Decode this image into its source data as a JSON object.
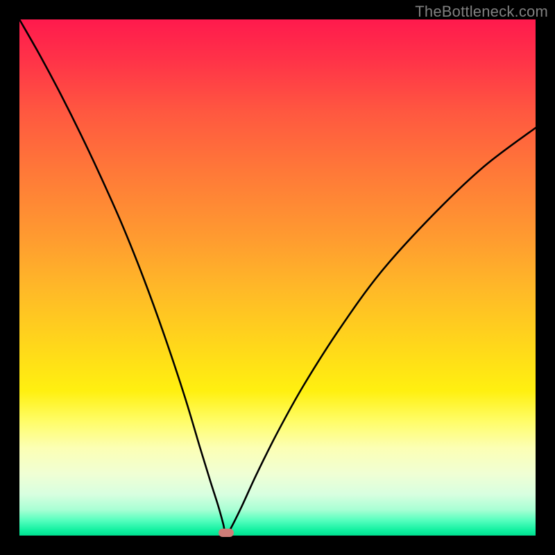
{
  "watermark": "TheBottleneck.com",
  "chart_data": {
    "type": "line",
    "title": "",
    "xlabel": "",
    "ylabel": "",
    "xlim": [
      0,
      100
    ],
    "ylim": [
      0,
      100
    ],
    "grid": false,
    "legend": false,
    "marker": {
      "x": 40,
      "y": 0
    },
    "series": [
      {
        "name": "curve",
        "x": [
          0,
          4,
          8,
          12,
          16,
          20,
          24,
          28,
          32,
          35,
          37,
          38.5,
          39.5,
          40,
          41,
          43,
          46,
          50,
          55,
          62,
          70,
          80,
          90,
          100
        ],
        "y": [
          100,
          93,
          85.5,
          77.5,
          69,
          60,
          50,
          39,
          27,
          17,
          10.5,
          5.8,
          2.2,
          0,
          1.5,
          5.5,
          12,
          20,
          29,
          40,
          51,
          62,
          71.5,
          79
        ]
      }
    ],
    "background_gradient": {
      "top": "#ff1a4d",
      "bottom": "#00e090"
    }
  }
}
